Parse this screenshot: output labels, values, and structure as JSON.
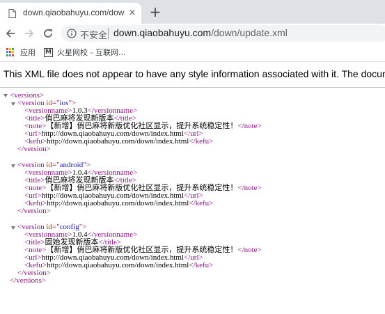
{
  "browser": {
    "tab": {
      "title": "down.qiaobahuyu.com/down/",
      "close_glyph": "×"
    },
    "new_tab_glyph": "+",
    "omnibox": {
      "security_label": "不安全",
      "url_host": "down.qiaobahuyu.com",
      "url_path": "/down/update.xml"
    },
    "bookmarks": [
      {
        "label": "应用",
        "icon": "apps-grid-icon"
      },
      {
        "label": "火星网校 - 互联网...",
        "icon": "m-logo-icon"
      }
    ]
  },
  "xml_viewer": {
    "header": "This XML file does not appear to have any style information associated with it. The document tree is shown below.",
    "root_open": "<versions>",
    "root_close": "</versions>",
    "versions": [
      {
        "id": "ios",
        "versionname": "1.0.3",
        "title": "俏巴麻将发现新版本",
        "note": "【新增】俏巴麻将新版优化社区显示，提升系统稳定性！",
        "url": "http://down.qiaobahuyu.com/down/index.html",
        "kefu": "http://down.qiaobahuyu.com/down/index.html"
      },
      {
        "id": "android",
        "versionname": "1.0.4",
        "title": "俏巴麻将发现新版本",
        "note": "【新增】俏巴麻将新版优化社区显示，提升系统稳定性！",
        "url": "http://down.qiaobahuyu.com/down/index.html",
        "kefu": "http://down.qiaobahuyu.com/down/index.html"
      },
      {
        "id": "config",
        "versionname": "1.0.4",
        "title": "固始发现新版本",
        "note": "【新增】俏巴麻将新版优化社区显示，提升系统稳定性！",
        "url": "http://down.qiaobahuyu.com/down/index.html",
        "kefu": "http://down.qiaobahuyu.com/down/index.html"
      }
    ]
  },
  "colors": {
    "tag": "#881280",
    "attr_name": "#994500",
    "attr_value": "#1a1aa6",
    "tabstrip": "#dee1e6",
    "omnibox": "#f1f3f4"
  }
}
